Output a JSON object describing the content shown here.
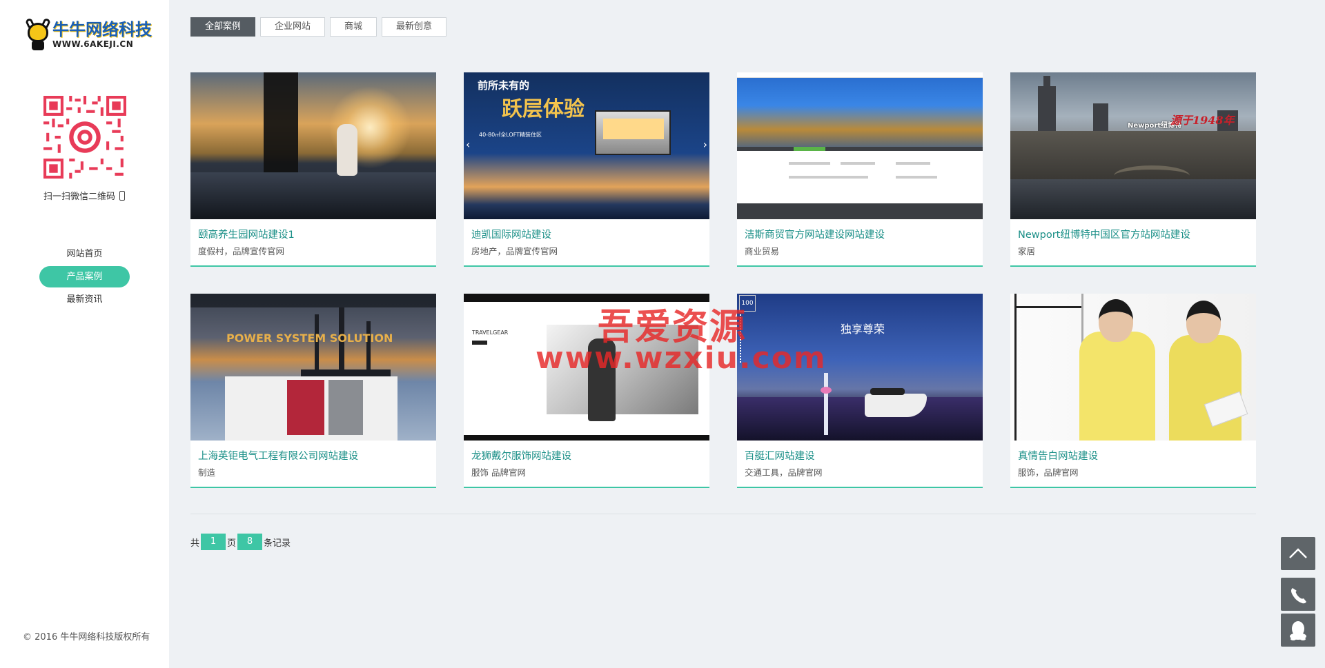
{
  "sidebar": {
    "logo_cn": "牛牛网络科技",
    "logo_en": "WWW.6AKEJI.CN",
    "qr_caption": "扫一扫微信二维码",
    "nav": [
      {
        "label": "网站首页",
        "active": false
      },
      {
        "label": "产品案例",
        "active": true
      },
      {
        "label": "最新资讯",
        "active": false
      }
    ],
    "copyright": "© 2016 牛牛网络科技版权所有"
  },
  "tabs": [
    {
      "label": "全部案例",
      "active": true
    },
    {
      "label": "企业网站",
      "active": false
    },
    {
      "label": "商城",
      "active": false
    },
    {
      "label": "最新创意",
      "active": false
    }
  ],
  "cards": [
    {
      "title": "颐高养生园网站建设1",
      "tags": "度假村，品牌宣传官网"
    },
    {
      "title": "迪凯国际网站建设",
      "tags": "房地产，品牌宣传官网"
    },
    {
      "title": "洁斯商贸官方网站建设网站建设",
      "tags": "商业贸易"
    },
    {
      "title": "Newport纽博特中国区官方站网站建设",
      "tags": "家居"
    },
    {
      "title": "上海英钜电气工程有限公司网站建设",
      "tags": "制造"
    },
    {
      "title": "龙狮戴尔服饰网站建设",
      "tags": "服饰 品牌官网"
    },
    {
      "title": "百艇汇网站建设",
      "tags": "交通工具，品牌官网"
    },
    {
      "title": "真情告白网站建设",
      "tags": "服饰，品牌官网"
    }
  ],
  "thumbs": {
    "t2_line1": "前所未有的",
    "t2_line2": "跃层体验",
    "t2_sub": "40-80㎡全LOFT精装住区",
    "t4_line1": "Newport纽博特",
    "t4_line2": "源于1948年",
    "t5_heading": "POWER SYSTEM SOLUTION",
    "t6_heading": "TRAVELGEAR",
    "t7_heading": "独享尊荣",
    "t7_logo": "100"
  },
  "watermark": {
    "line1": "吾爱资源",
    "line2": "www.wzxiu.com"
  },
  "pagination": {
    "prefix": "共",
    "pages": "1",
    "mid": "页",
    "records": "8",
    "suffix": "条记录"
  },
  "float_buttons": [
    {
      "icon": "chevron-up-icon"
    },
    {
      "icon": "phone-icon"
    },
    {
      "icon": "qq-penguin-icon"
    }
  ],
  "colors": {
    "accent": "#3ec6a5",
    "title_link": "#1a8f87",
    "active_tab": "#555c62",
    "float_btn": "#5f6569"
  }
}
